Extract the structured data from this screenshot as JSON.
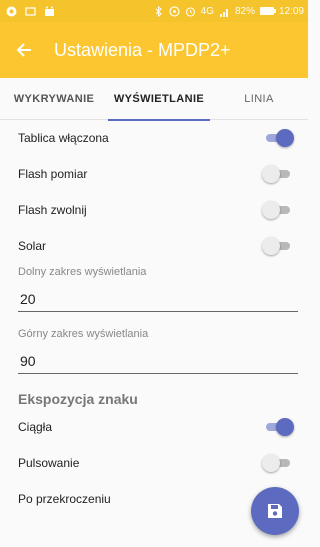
{
  "status_bar": {
    "battery": "82%",
    "signal": "4G",
    "time": "12:09"
  },
  "appbar": {
    "title": "Ustawienia - MPDP2+"
  },
  "tabs": [
    {
      "label": "WYKRYWANIE",
      "active": false
    },
    {
      "label": "WYŚWIETLANIE",
      "active": true
    },
    {
      "label": "LINIA",
      "active": false
    }
  ],
  "settings": {
    "tablica": {
      "label": "Tablica włączona",
      "on": true
    },
    "flash_pomiar": {
      "label": "Flash pomiar",
      "on": false
    },
    "flash_zwolnij": {
      "label": "Flash zwolnij",
      "on": false
    },
    "solar": {
      "label": "Solar",
      "on": false
    }
  },
  "fields": {
    "dolny": {
      "label": "Dolny zakres wyświetlania",
      "value": "20"
    },
    "gorny": {
      "label": "Górny zakres wyświetlania",
      "value": "90"
    }
  },
  "section_title": "Ekspozycja znaku",
  "exposure": {
    "ciagla": {
      "label": "Ciągła",
      "on": true
    },
    "pulsowanie": {
      "label": "Pulsowanie",
      "on": false
    },
    "po_przekroczeniu": {
      "label": "Po przekroczeniu"
    }
  },
  "colors": {
    "primary": "#fbc630",
    "accent": "#5c6bc0"
  }
}
